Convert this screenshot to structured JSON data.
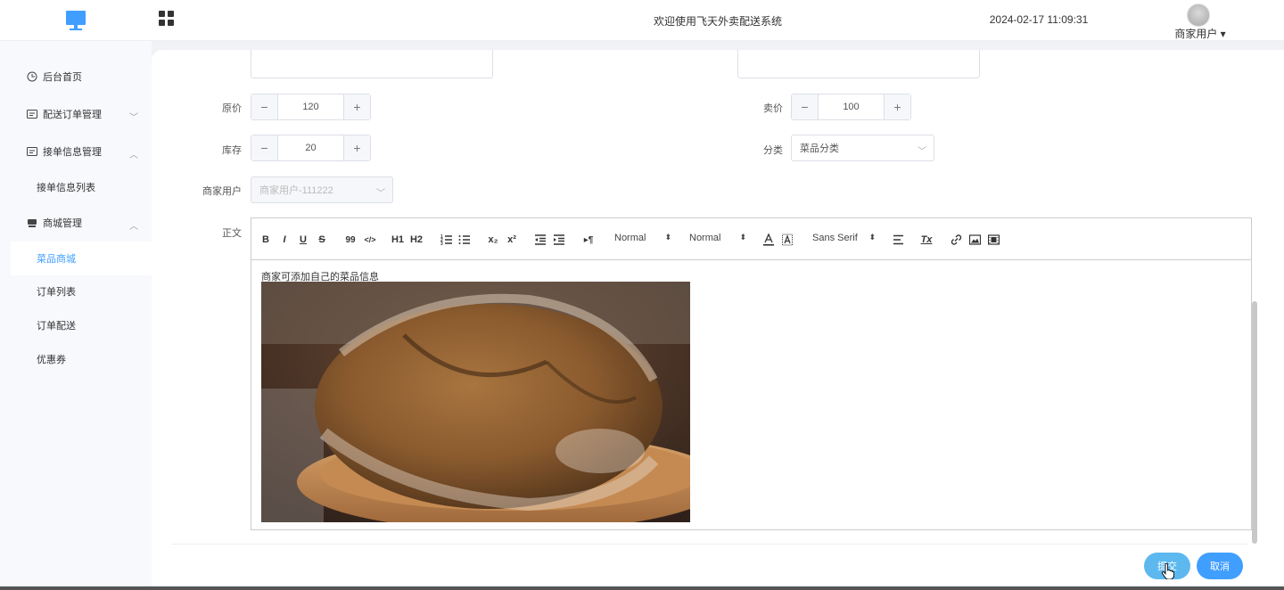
{
  "header": {
    "title": "欢迎使用飞天外卖配送系统",
    "datetime": "2024-02-17 11:09:31",
    "user_menu": "商家用户 ▾",
    "logo_icon": "monitor-icon",
    "apps_icon": "grid-icon"
  },
  "sidebar": {
    "items": [
      {
        "label": "后台首页",
        "icon": "clock-icon"
      },
      {
        "label": "配送订单管理",
        "icon": "list-icon"
      },
      {
        "label": "接单信息管理",
        "icon": "list-icon"
      },
      {
        "label": "接单信息列表"
      },
      {
        "label": "商城管理",
        "icon": "shop-icon"
      },
      {
        "label": "菜品商城"
      },
      {
        "label": "订单列表"
      },
      {
        "label": "订单配送"
      },
      {
        "label": "优惠券"
      }
    ],
    "active_item": "菜品商城",
    "accent_color": "#409eff"
  },
  "form": {
    "original_price_label": "原价",
    "original_price_value": "120",
    "sale_price_label": "卖价",
    "sale_price_value": "100",
    "stock_label": "库存",
    "stock_value": "20",
    "category_label": "分类",
    "category_placeholder": "菜品分类",
    "merchant_label": "商家用户",
    "merchant_value": "商家用户-111222",
    "content_label": "正文",
    "minus": "−",
    "plus": "+"
  },
  "editor": {
    "toolbar": {
      "bold": "B",
      "italic": "I",
      "underline": "U",
      "strike": "S",
      "blockquote": "99",
      "code": "</>",
      "h1": "H1",
      "h2": "H2",
      "subscript": "x₂",
      "superscript": "x²",
      "direction": "▸¶",
      "size_picker": "Normal",
      "header_picker": "Normal",
      "font_picker": "Sans Serif",
      "clean": "Tx"
    },
    "content_text": "商家可添加自己的菜品信息"
  },
  "actions": {
    "submit": "提交",
    "cancel": "取消"
  }
}
